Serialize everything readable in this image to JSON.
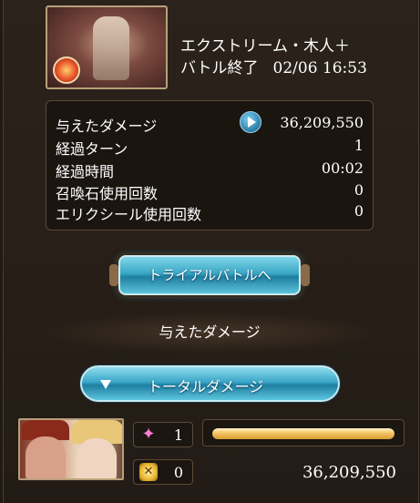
{
  "quest": {
    "title": "エクストリーム・木人＋",
    "status": "バトル終了",
    "datetime": "02/06 16:53",
    "element_icon": "fire-element-icon"
  },
  "stats": [
    {
      "label": "与えたダメージ",
      "value": "36,209,550"
    },
    {
      "label": "経過ターン",
      "value": "1"
    },
    {
      "label": "経過時間",
      "value": "00:02"
    },
    {
      "label": "召喚石使用回数",
      "value": "0"
    },
    {
      "label": "エリクシール使用回数",
      "value": "0"
    }
  ],
  "trial_button_label": "トライアルバトルへ",
  "damage_heading": "与えたダメージ",
  "total_button_label": "トータルダメージ",
  "player": {
    "skill_count": "1",
    "ca_count": "0",
    "hp_fraction": 1.0,
    "damage": "36,209,550"
  }
}
